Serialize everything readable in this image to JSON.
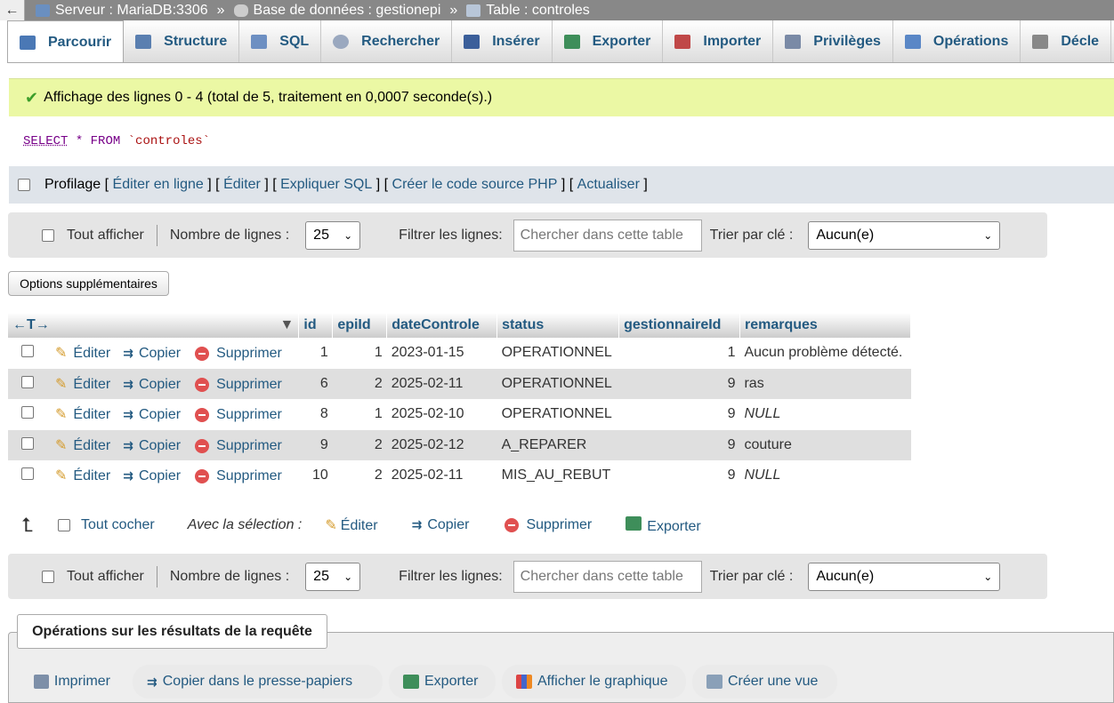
{
  "breadcrumb": {
    "back": "←",
    "server": "Serveur : MariaDB:3306",
    "database": "Base de données : gestionepi",
    "table": "Table : controles",
    "separator": "»"
  },
  "tabs": [
    {
      "label": "Parcourir",
      "icon": "browse-icon",
      "color": "#4a78b5"
    },
    {
      "label": "Structure",
      "icon": "structure-icon",
      "color": "#5a7fb0"
    },
    {
      "label": "SQL",
      "icon": "sql-icon",
      "color": "#6d8fc2"
    },
    {
      "label": "Rechercher",
      "icon": "search-icon",
      "color": "#9aa8bf"
    },
    {
      "label": "Insérer",
      "icon": "insert-icon",
      "color": "#3b5f9a"
    },
    {
      "label": "Exporter",
      "icon": "export-icon",
      "color": "#3e8e5a"
    },
    {
      "label": "Importer",
      "icon": "import-icon",
      "color": "#c04848"
    },
    {
      "label": "Privilèges",
      "icon": "privileges-icon",
      "color": "#7a8aa6"
    },
    {
      "label": "Opérations",
      "icon": "wrench-icon",
      "color": "#5a87c6"
    },
    {
      "label": "Décle",
      "icon": "triggers-icon",
      "color": "#888888"
    }
  ],
  "message": {
    "text": "Affichage des lignes 0 - 4 (total de 5, traitement en 0,0007 seconde(s).)"
  },
  "sql": {
    "select": "SELECT",
    "star": "*",
    "from": "FROM",
    "table": "`controles`"
  },
  "profiling": {
    "label": "Profilage",
    "open": "[",
    "sep": "] [",
    "close": "]",
    "links": [
      "Éditer en ligne",
      "Éditer",
      "Expliquer SQL",
      "Créer le code source PHP",
      "Actualiser"
    ]
  },
  "nav": {
    "show_all": "Tout afficher",
    "rows_label": "Nombre de lignes :",
    "rows_value": "25",
    "filter_label": "Filtrer les lignes:",
    "filter_placeholder": "Chercher dans cette table",
    "sort_label": "Trier par clé :",
    "sort_value": "Aucun(e)"
  },
  "extra_options": "Options supplémentaires",
  "table": {
    "arrows": "←T→",
    "columns": [
      "id",
      "epiId",
      "dateControle",
      "status",
      "gestionnaireId",
      "remarques"
    ],
    "actions": {
      "edit": "Éditer",
      "copy": "Copier",
      "delete": "Supprimer"
    },
    "rows": [
      {
        "id": "1",
        "epiId": "1",
        "date": "2023-01-15",
        "status": "OPERATIONNEL",
        "gest": "1",
        "rem": "Aucun problème détecté.",
        "null": false
      },
      {
        "id": "6",
        "epiId": "2",
        "date": "2025-02-11",
        "status": "OPERATIONNEL",
        "gest": "9",
        "rem": "ras",
        "null": false
      },
      {
        "id": "8",
        "epiId": "1",
        "date": "2025-02-10",
        "status": "OPERATIONNEL",
        "gest": "9",
        "rem": "NULL",
        "null": true
      },
      {
        "id": "9",
        "epiId": "2",
        "date": "2025-02-12",
        "status": "A_REPARER",
        "gest": "9",
        "rem": "couture",
        "null": false
      },
      {
        "id": "10",
        "epiId": "2",
        "date": "2025-02-11",
        "status": "MIS_AU_REBUT",
        "gest": "9",
        "rem": "NULL",
        "null": true
      }
    ]
  },
  "with_selection": {
    "check_all": "Tout cocher",
    "label": "Avec la sélection :",
    "edit": "Éditer",
    "copy": "Copier",
    "delete": "Supprimer",
    "export": "Exporter"
  },
  "results_ops": {
    "legend": "Opérations sur les résultats de la requête",
    "print": "Imprimer",
    "copy_clipboard": "Copier dans le presse-papiers",
    "export": "Exporter",
    "chart": "Afficher le graphique",
    "view": "Créer une vue"
  },
  "colors": {
    "link": "#235a81",
    "success_bg": "#ebf8a4",
    "row_alt": "#dfdfdf"
  }
}
